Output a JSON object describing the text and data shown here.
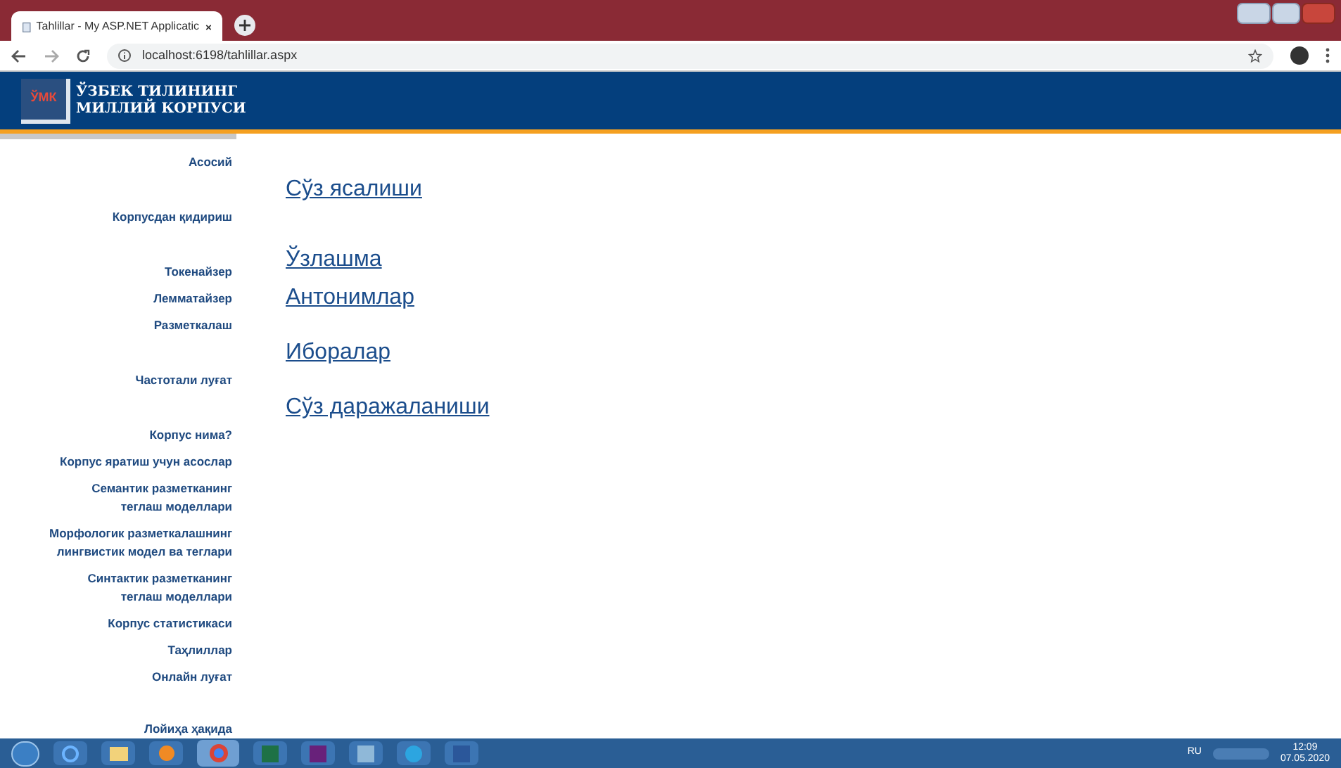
{
  "browser": {
    "tab_title": "Tahlillar - My ASP.NET Applicatic",
    "url": "localhost:6198/tahlillar.aspx"
  },
  "header": {
    "logo": "ЎМК",
    "title_lines": [
      "ЎЗБЕК ТИЛИНИНГ",
      "МИЛЛИЙ КОРПУСИ"
    ]
  },
  "sidebar": {
    "groups": [
      {
        "items": [
          "Асосий"
        ]
      },
      {
        "items": [
          "Корпусдан қидириш"
        ]
      },
      {
        "items": [
          "Токенайзер",
          "Лемматайзер",
          "Разметкалаш"
        ]
      },
      {
        "items": [
          "Частотали луғат"
        ]
      },
      {
        "items": [
          "Корпус нима?",
          "Корпус яратиш учун асослар",
          "Семантик разметканинг\nтеглаш моделлари",
          "Морфологик разметкалашнинг\nлингвистик модел ва теглари",
          "Синтактик разметканинг\nтеглаш моделлари",
          "Корпус статистикаси",
          "Таҳлиллар",
          "Онлайн луғат"
        ]
      },
      {
        "items": [
          "Лойиҳа ҳақида"
        ]
      }
    ]
  },
  "content": {
    "groups": [
      {
        "links": [
          "Сўз ясалиши"
        ]
      },
      {
        "links": [
          "Ўзлашма",
          "Антонимлар"
        ]
      },
      {
        "links": [
          "Иборалар"
        ]
      },
      {
        "links": [
          "Сўз даражаланиши"
        ]
      }
    ]
  },
  "taskbar": {
    "language": "RU",
    "time": "12:09",
    "date": "07.05.2020"
  }
}
